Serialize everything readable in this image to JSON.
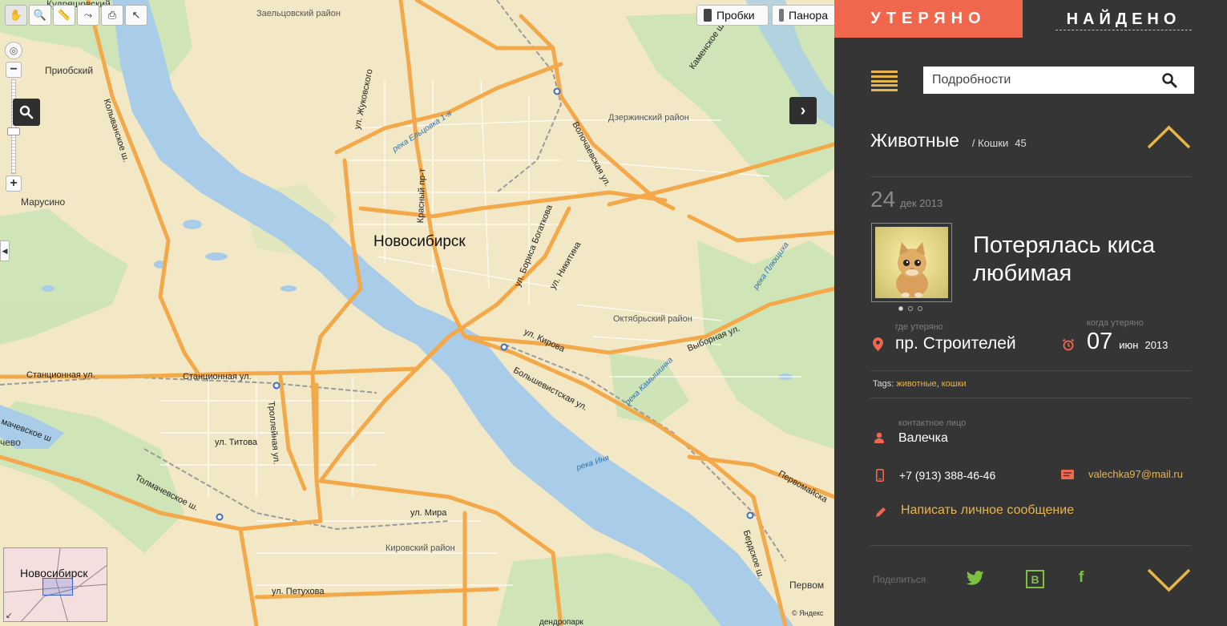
{
  "map": {
    "districts": [
      {
        "id": "zaelts",
        "text": "Заельцовский район"
      },
      {
        "id": "dzerzh",
        "text": "Дзержинский район"
      },
      {
        "id": "oktyab",
        "text": "Октябрьский район"
      },
      {
        "id": "kirov",
        "text": "Кировский район"
      }
    ],
    "settlements": [
      {
        "id": "kudryash",
        "text": "Кудряшовский"
      },
      {
        "id": "priob",
        "text": "Приобский"
      },
      {
        "id": "marusino",
        "text": "Марусино"
      },
      {
        "id": "chevo",
        "text": "чево"
      },
      {
        "id": "pervom",
        "text": "Первом"
      }
    ],
    "city": "Новосибирск",
    "streets": [
      {
        "id": "zhukov",
        "text": "ул. Жуковского"
      },
      {
        "id": "krasny",
        "text": "Красный пр-т"
      },
      {
        "id": "bogatkova",
        "text": "ул. Бориса Богаткова"
      },
      {
        "id": "nikitina",
        "text": "ул. Никитина"
      },
      {
        "id": "volochaev",
        "text": "Волочаевская ул."
      },
      {
        "id": "kamensk",
        "text": "Каменское ш."
      },
      {
        "id": "kolyvan",
        "text": "Колыванское ш."
      },
      {
        "id": "stanc1",
        "text": "Станционная ул."
      },
      {
        "id": "stanc2",
        "text": "Станционная ул."
      },
      {
        "id": "trolley",
        "text": "Троллейная ул."
      },
      {
        "id": "titova",
        "text": "ул. Титова"
      },
      {
        "id": "kirova",
        "text": "ул. Кирова"
      },
      {
        "id": "bolshev",
        "text": "Большевистская ул."
      },
      {
        "id": "vybornaya",
        "text": "Выборная ул."
      },
      {
        "id": "tolmach",
        "text": "Толмачевское ш."
      },
      {
        "id": "tolmach2",
        "text": "мачевское ш"
      },
      {
        "id": "mira",
        "text": "ул. Мира"
      },
      {
        "id": "petuhova",
        "text": "ул. Петухова"
      },
      {
        "id": "berdsk",
        "text": "Бердское ш."
      },
      {
        "id": "pervomay",
        "text": "Первомайска"
      },
      {
        "id": "dendro",
        "text": "дендропарк"
      }
    ],
    "rivers": [
      {
        "id": "eltsovka",
        "text": "река Ельцовка 1-я"
      },
      {
        "id": "plyushiha",
        "text": "река Плющиха"
      },
      {
        "id": "kamyshinka",
        "text": "река Камышинка"
      },
      {
        "id": "inya",
        "text": "река Иня"
      }
    ],
    "toolbar_icons": [
      "hand-icon",
      "magnifier-icon",
      "ruler-icon",
      "route-icon",
      "print-icon",
      "cursor-icon"
    ],
    "traffic_label": "Пробки",
    "panorama_label": "Панора",
    "minimap_label": "Новосибирск",
    "copyright": "© Яндекс"
  },
  "panel": {
    "tab_lost": "УТЕРЯНО",
    "tab_found": "НАЙДЕНО",
    "search_placeholder": "Подробности",
    "category": "Животные",
    "subcategory": "/ Кошки",
    "count": "45",
    "date_day": "24",
    "date_month_year": "дек  2013",
    "title": "Потерялась киса любимая",
    "where_label": "где утеряно",
    "where_value": "пр. Строителей",
    "when_label": "когда утеряно",
    "when_day": "07",
    "when_month": "июн",
    "when_year": "2013",
    "tags_label": "Tags:",
    "tags": [
      "животные",
      "кошки"
    ],
    "contact_label": "контактное лицо",
    "contact_name": "Валечка",
    "phone": "+7 (913) 388-46-46",
    "email": "valechka97@mail.ru",
    "message_link": "Написать личное сообщение",
    "share_label": "Поделиться",
    "vk_letter": "B",
    "fb_letter": "f",
    "colors": {
      "accent": "#f0674e",
      "highlight": "#e8b54d",
      "social": "#7cc142",
      "panel_bg": "#353535"
    }
  }
}
